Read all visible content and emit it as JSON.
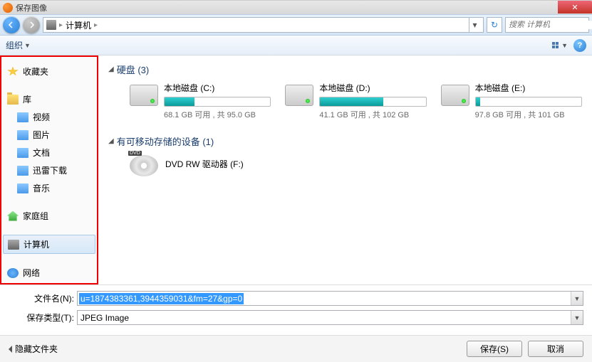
{
  "titlebar": {
    "title": "保存图像"
  },
  "nav": {
    "breadcrumb_text": "计算机",
    "search_placeholder": "搜索 计算机"
  },
  "toolbar": {
    "organize": "组织"
  },
  "sidebar": {
    "favorites": "收藏夹",
    "libraries": "库",
    "lib_items": [
      "视频",
      "图片",
      "文档",
      "迅雷下载",
      "音乐"
    ],
    "homegroup": "家庭组",
    "computer": "计算机",
    "network": "网络"
  },
  "content": {
    "hdd_header": "硬盘 (3)",
    "removable_header": "有可移动存储的设备 (1)",
    "drives": [
      {
        "name": "本地磁盘 (C:)",
        "fill_pct": 28,
        "info": "68.1 GB 可用 , 共 95.0 GB"
      },
      {
        "name": "本地磁盘 (D:)",
        "fill_pct": 60,
        "info": "41.1 GB 可用 , 共 102 GB"
      },
      {
        "name": "本地磁盘 (E:)",
        "fill_pct": 4,
        "info": "97.8 GB 可用 , 共 101 GB"
      }
    ],
    "dvd_name": "DVD RW 驱动器 (F:)"
  },
  "fields": {
    "filename_label": "文件名(N):",
    "filename_value": "u=1874383361,3944359031&fm=27&gp=0",
    "filetype_label": "保存类型(T):",
    "filetype_value": "JPEG Image"
  },
  "footer": {
    "hide_folders": "隐藏文件夹",
    "save": "保存(S)",
    "cancel": "取消"
  }
}
